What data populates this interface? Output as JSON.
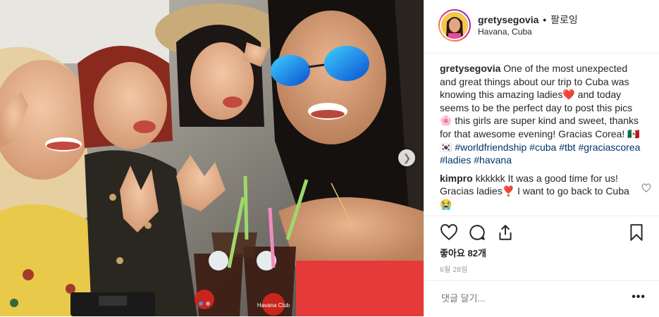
{
  "post": {
    "photo": {
      "alt": "Four women smiling for a selfie holding drinks with straws",
      "cup_brand": "Havana Club",
      "slide_count": 2,
      "active_slide": 1
    },
    "header": {
      "username": "gretysegovia",
      "dot": "•",
      "follow_label": "팔로잉",
      "location": "Havana, Cuba"
    },
    "caption": {
      "username": "gretysegovia",
      "text_1": "One of the most unexpected and great things about our trip to Cuba was knowing this amazing ladies",
      "emoji_1": "❤️",
      "text_2": " and today seems to be the perfect day to post this pics",
      "emoji_2": "🌸",
      "text_3": " this girls are super kind and sweet, thanks for that awesome evening! Gracias Corea! ",
      "emoji_3": "🇲🇽 🇰🇷",
      "hashtags": [
        "#worldfriendship",
        "#cuba",
        "#tbt",
        "#graciascorea",
        "#ladies",
        "#havana"
      ]
    },
    "comment": {
      "username": "kimpro",
      "text_1": "kkkkkk It was a good time for us! Gracias ladies",
      "emoji_1": "❣️",
      "text_2": " I want to go back to Cuba",
      "emoji_2": "😭"
    },
    "likes": "좋아요 82개",
    "date": "6월 28일",
    "add_comment_placeholder": "댓글 달기...",
    "more_label": "•••",
    "colors": {
      "hashtag": "#003569",
      "active_dot": "#3897f0",
      "border": "#efefef",
      "muted": "#999999"
    }
  }
}
